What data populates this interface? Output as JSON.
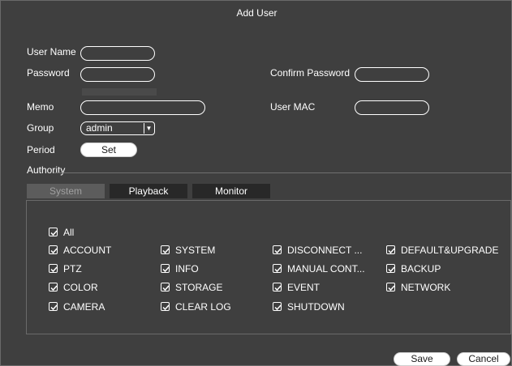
{
  "dialog": {
    "title": "Add User"
  },
  "form": {
    "user_name_label": "User Name",
    "password_label": "Password",
    "confirm_password_label": "Confirm Password",
    "memo_label": "Memo",
    "user_mac_label": "User MAC",
    "group_label": "Group",
    "group_value": "admin",
    "period_label": "Period",
    "period_button": "Set",
    "authority_label": "Authority"
  },
  "tabs": [
    {
      "label": "System",
      "active": true
    },
    {
      "label": "Playback",
      "active": false
    },
    {
      "label": "Monitor",
      "active": false
    }
  ],
  "permissions": {
    "all": {
      "label": "All",
      "checked": true
    },
    "col1": [
      {
        "label": "ACCOUNT",
        "checked": true
      },
      {
        "label": "PTZ",
        "checked": true
      },
      {
        "label": "COLOR",
        "checked": true
      },
      {
        "label": "CAMERA",
        "checked": true
      }
    ],
    "col2": [
      {
        "label": "SYSTEM",
        "checked": true
      },
      {
        "label": "INFO",
        "checked": true
      },
      {
        "label": "STORAGE",
        "checked": true
      },
      {
        "label": "CLEAR LOG",
        "checked": true
      }
    ],
    "col3": [
      {
        "label": "DISCONNECT ...",
        "checked": true
      },
      {
        "label": "MANUAL CONT...",
        "checked": true
      },
      {
        "label": "EVENT",
        "checked": true
      },
      {
        "label": "SHUTDOWN",
        "checked": true
      }
    ],
    "col4": [
      {
        "label": "DEFAULT&UPGRADE",
        "checked": true
      },
      {
        "label": "BACKUP",
        "checked": true
      },
      {
        "label": "NETWORK",
        "checked": true
      }
    ]
  },
  "footer": {
    "save": "Save",
    "cancel": "Cancel"
  }
}
